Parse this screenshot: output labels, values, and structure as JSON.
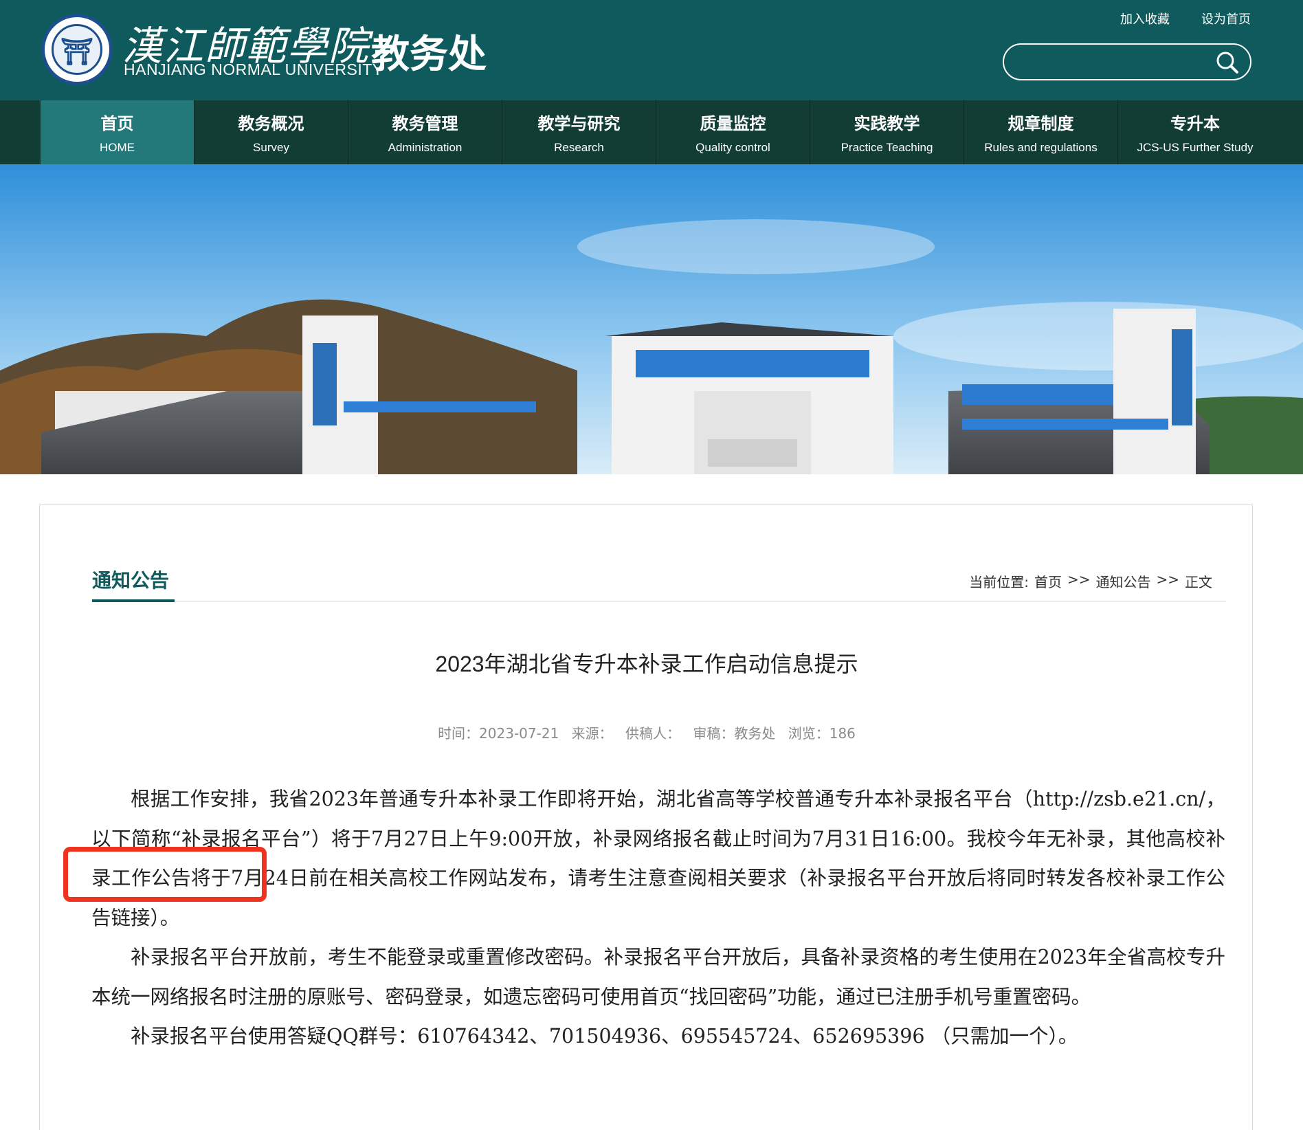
{
  "header": {
    "university_cn": "漢江師範學院",
    "university_en": "HANJIANG NORMAL UNIVERSITY",
    "department": "教务处",
    "top_links": [
      "加入收藏",
      "设为首页"
    ],
    "search": {
      "value": "",
      "placeholder": ""
    },
    "colors": {
      "header_bg": "#0e5a5c",
      "nav_bg": "#123d34",
      "nav_active": "#23787a"
    }
  },
  "nav": [
    {
      "cn": "首页",
      "en": "HOME",
      "active": true
    },
    {
      "cn": "教务概况",
      "en": "Survey"
    },
    {
      "cn": "教务管理",
      "en": "Administration"
    },
    {
      "cn": "教学与研究",
      "en": "Research"
    },
    {
      "cn": "质量监控",
      "en": "Quality control"
    },
    {
      "cn": "实践教学",
      "en": "Practice Teaching"
    },
    {
      "cn": "规章制度",
      "en": "Rules and regulations"
    },
    {
      "cn": "专升本",
      "en": "JCS-US Further Study"
    }
  ],
  "content": {
    "section_title": "通知公告",
    "breadcrumb": {
      "label": "当前位置:",
      "home": "首页",
      "sep": ">>",
      "list": "通知公告",
      "current": "正文"
    },
    "article": {
      "title": "2023年湖北省专升本补录工作启动信息提示",
      "meta": {
        "time": "时间：2023-07-21",
        "source": "来源：",
        "author": "供稿人：",
        "reviewer": "审稿：教务处",
        "views": "浏览：186"
      },
      "paragraphs": [
        "根据工作安排，我省2023年普通专升本补录工作即将开始，湖北省高等学校普通专升本补录报名平台（http://zsb.e21.cn/，以下简称“补录报名平台”）将于7月27日上午9:00开放，补录网络报名截止时间为7月31日16:00。我校今年无补录，其他高校补录工作公告将于7月24日前在相关高校工作网站发布，请考生注意查阅相关要求（补录报名平台开放后将同时转发各校补录工作公告链接）。",
        "补录报名平台开放前，考生不能登录或重置修改密码。补录报名平台开放后，具备补录资格的考生使用在2023年全省高校专升本统一网络报名时注册的原账号、密码登录，如遗忘密码可使用首页“找回密码”功能，通过已注册手机号重置密码。",
        "补录报名平台使用答疑QQ群号：610764342、701504936、695545724、652695396 （只需加一个）。"
      ],
      "highlight_color": "#f0331f"
    }
  }
}
